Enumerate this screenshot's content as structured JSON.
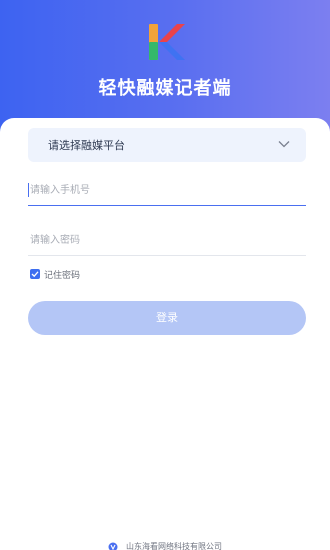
{
  "app": {
    "title": "轻快融媒记者端"
  },
  "platform_select": {
    "placeholder": "请选择融媒平台"
  },
  "phone_field": {
    "placeholder": "请输入手机号",
    "value": ""
  },
  "password_field": {
    "placeholder": "请输入密码",
    "value": ""
  },
  "remember": {
    "label": "记住密码",
    "checked": true
  },
  "login": {
    "label": "登录"
  },
  "footer": {
    "company": "山东海看网络科技有限公司"
  },
  "colors": {
    "header_gradient_start": "#3d63f1",
    "header_gradient_end": "#7c7ff0",
    "accent": "#4a6ff0",
    "button_disabled": "#b4c6f6",
    "select_bg": "#eef3fd"
  },
  "icons": {
    "logo": "k-logo-icon",
    "chevron": "chevron-down-icon",
    "checkbox": "checkmark-icon",
    "footer_logo": "company-logo-icon"
  }
}
